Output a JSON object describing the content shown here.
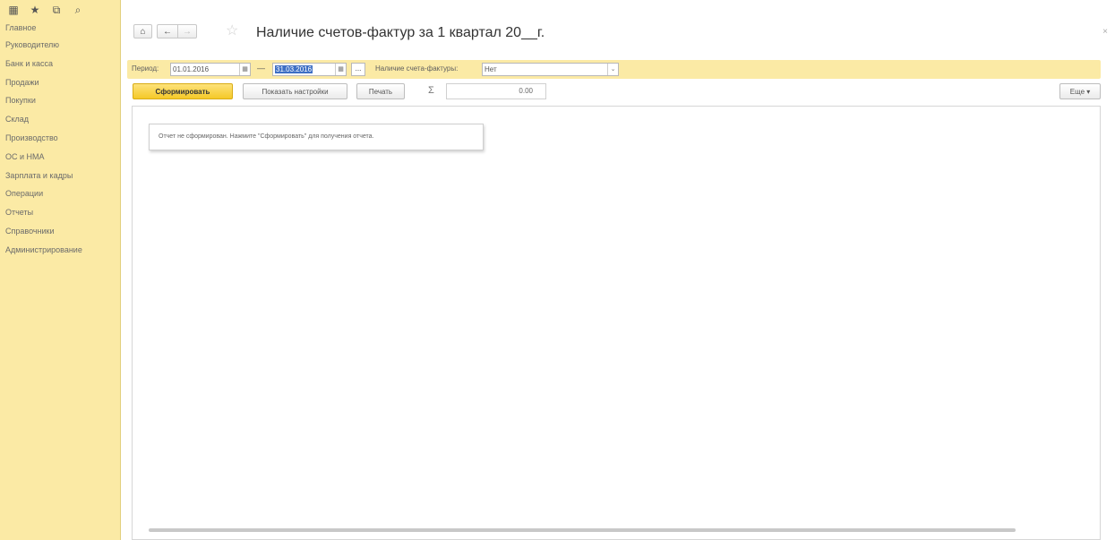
{
  "sidebar": {
    "tools": [
      {
        "name": "apps-grid-icon",
        "glyph": "▦"
      },
      {
        "name": "favorites-star-icon",
        "glyph": "★"
      },
      {
        "name": "history-icon",
        "glyph": "⧉"
      },
      {
        "name": "search-icon",
        "glyph": "⌕"
      }
    ],
    "items": [
      "Главное",
      "Руководителю",
      "Банк и касса",
      "Продажи",
      "Покупки",
      "Склад",
      "Производство",
      "ОС и НМА",
      "Зарплата и кадры",
      "Операции",
      "Отчеты",
      "Справочники",
      "Администрирование"
    ]
  },
  "header": {
    "home_glyph": "⌂",
    "back_glyph": "←",
    "forward_glyph": "→",
    "star_glyph": "☆",
    "title": "Наличие счетов-фактур за 1 квартал 20__г.",
    "close_glyph": "×"
  },
  "filters": {
    "period_label": "Период:",
    "date_from": "01.01.2016",
    "calendar_glyph": "▦",
    "dash": "—",
    "date_to": "31.03.2016",
    "dots_label": "...",
    "invoices_label": "Наличие счета-фактуры:",
    "invoices_value": "Нет",
    "dropdown_glyph": "⌄"
  },
  "commands": {
    "generate_label": "Сформировать",
    "settings_label": "Показать настройки",
    "print_label": "Печать",
    "sigma_glyph": "Σ",
    "sum_value": "0.00",
    "more_label": "Еще ▾"
  },
  "report": {
    "notice": "Отчет не сформирован. Нажмите \"Сформировать\" для получения отчета."
  },
  "colors": {
    "sidebar_bg": "#fbeaa5",
    "accent_button": "#f5c928",
    "selection": "#3e6fc4"
  }
}
